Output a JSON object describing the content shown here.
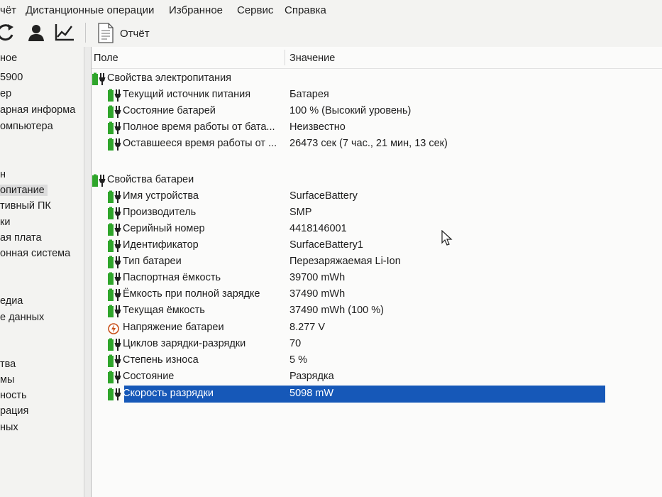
{
  "menu": {
    "items": [
      "чёт",
      "Дистанционные операции",
      "Избранное",
      "Сервис",
      "Справка"
    ]
  },
  "toolbar": {
    "icons": [
      "refresh-icon",
      "user-icon",
      "chart-icon",
      "report-icon"
    ],
    "report_label": "Отчёт"
  },
  "left_panel": {
    "items": [
      "ное",
      "5900",
      "ер",
      "арная информа",
      "омпьютера",
      "н",
      "опитание",
      "тивный ПК",
      "ки",
      "ая плата",
      "онная система",
      "едиа",
      "е данных",
      "тва",
      "мы",
      "ность",
      "рация",
      "ных"
    ],
    "selected_index": 6
  },
  "columns": {
    "field": "Поле",
    "value": "Значение"
  },
  "groups": [
    {
      "title": "Свойства электропитания",
      "rows": [
        {
          "field": "Текущий источник питания",
          "value": "Батарея",
          "icon": "battery-icon"
        },
        {
          "field": "Состояние батарей",
          "value": "100 % (Высокий уровень)",
          "icon": "battery-icon"
        },
        {
          "field": "Полное время работы от бата...",
          "value": "Неизвестно",
          "icon": "battery-icon"
        },
        {
          "field": "Оставшееся время работы от ...",
          "value": "26473 сек (7 час., 21 мин, 13 сек)",
          "icon": "battery-icon"
        }
      ]
    },
    {
      "title": "Свойства батареи",
      "rows": [
        {
          "field": "Имя устройства",
          "value": "SurfaceBattery",
          "icon": "battery-icon"
        },
        {
          "field": "Производитель",
          "value": "SMP",
          "icon": "battery-icon"
        },
        {
          "field": "Серийный номер",
          "value": "4418146001",
          "icon": "battery-icon"
        },
        {
          "field": "Идентификатор",
          "value": "SurfaceBattery1",
          "icon": "battery-icon"
        },
        {
          "field": "Тип батареи",
          "value": "Перезаряжаемая Li-Ion",
          "icon": "battery-icon"
        },
        {
          "field": "Паспортная ёмкость",
          "value": "39700 mWh",
          "icon": "battery-icon"
        },
        {
          "field": "Ёмкость при полной зарядке",
          "value": "37490 mWh",
          "icon": "battery-icon"
        },
        {
          "field": "Текущая ёмкость",
          "value": "37490 mWh  (100 %)",
          "icon": "battery-icon"
        },
        {
          "field": "Напряжение батареи",
          "value": "8.277 V",
          "icon": "voltage-icon"
        },
        {
          "field": "Циклов зарядки-разрядки",
          "value": "70",
          "icon": "battery-icon"
        },
        {
          "field": "Степень износа",
          "value": "5 %",
          "icon": "battery-icon"
        },
        {
          "field": "Состояние",
          "value": "Разрядка",
          "icon": "battery-icon"
        },
        {
          "field": "Скорость разрядки",
          "value": "5098 mW",
          "icon": "battery-icon",
          "selected": true
        }
      ]
    }
  ],
  "colors": {
    "battery_green": "#2fa52b",
    "selection_blue": "#1658b8",
    "voltage_orange": "#c8501a"
  }
}
